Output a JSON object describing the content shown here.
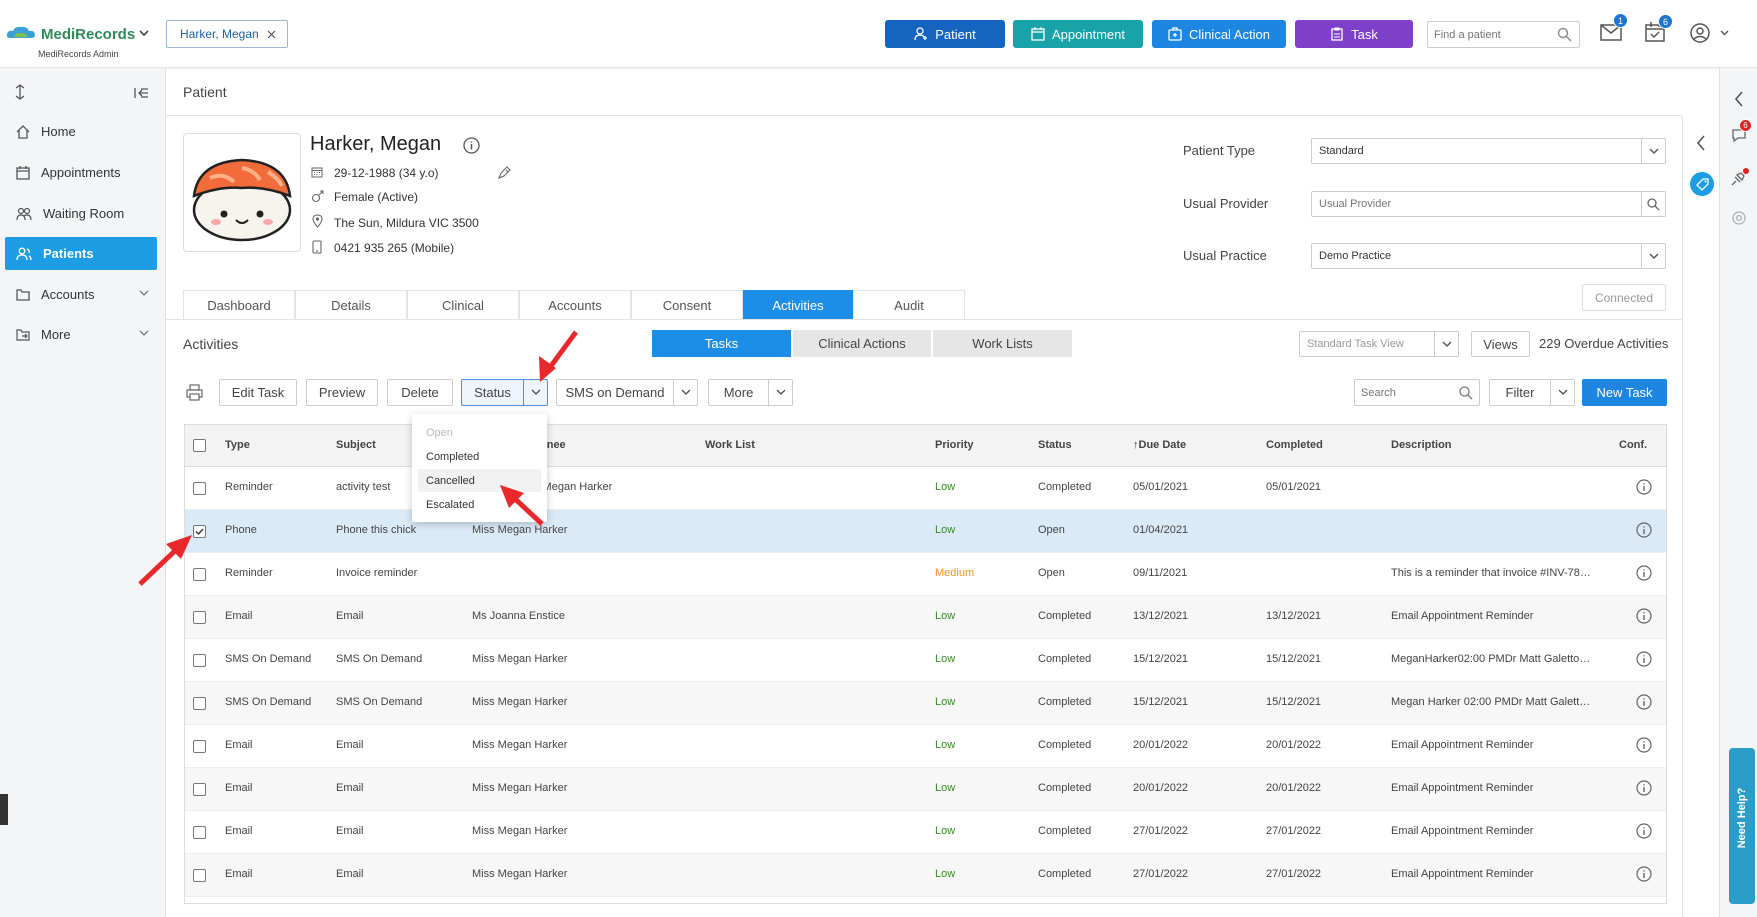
{
  "brand": {
    "name": "MediRecords",
    "sub": "MediRecords Admin"
  },
  "open_patient_tab": "Harker, Megan",
  "top_actions": {
    "patient": "Patient",
    "appointment": "Appointment",
    "clinical_action": "Clinical Action",
    "task": "Task"
  },
  "search": {
    "placeholder": "Find a patient"
  },
  "counts": {
    "mail": "1",
    "tasks": "6",
    "rail_chat": "6"
  },
  "colors": {
    "patient": "#1565c0",
    "appointment": "#17a3a8",
    "clinical_action": "#1d86e0",
    "task": "#7e3fc9",
    "active_nav": "#1d9de3",
    "active_tab": "#1d8ee8",
    "low": "#3a8a2a",
    "medium": "#f0941c",
    "arrow": "#e8282b"
  },
  "sidebar": {
    "items": [
      {
        "label": "Home",
        "icon": "home-icon"
      },
      {
        "label": "Appointments",
        "icon": "calendar-icon"
      },
      {
        "label": "Waiting Room",
        "icon": "people-icon"
      },
      {
        "label": "Patients",
        "icon": "patients-icon"
      },
      {
        "label": "Accounts",
        "icon": "folder-icon"
      },
      {
        "label": "More",
        "icon": "more-icon"
      }
    ]
  },
  "page_title": "Patient",
  "patient": {
    "name": "Harker, Megan",
    "dob": "29-12-1988 (34 y.o)",
    "gender": "Female (Active)",
    "address": "The Sun, Mildura VIC 3500",
    "phone": "0421 935 265 (Mobile)"
  },
  "patient_fields": {
    "type_label": "Patient Type",
    "type_value": "Standard",
    "provider_label": "Usual Provider",
    "provider_placeholder": "Usual Provider",
    "practice_label": "Usual Practice",
    "practice_value": "Demo Practice",
    "connected": "Connected"
  },
  "tabs": [
    "Dashboard",
    "Details",
    "Clinical",
    "Accounts",
    "Consent",
    "Activities",
    "Audit"
  ],
  "activities": {
    "title": "Activities",
    "subtabs": [
      "Tasks",
      "Clinical Actions",
      "Work Lists"
    ],
    "view_value": "Standard Task View",
    "views_label": "Views",
    "overdue": "229 Overdue Activities"
  },
  "toolbar": {
    "edit": "Edit Task",
    "preview": "Preview",
    "delete": "Delete",
    "status": "Status",
    "sms": "SMS on Demand",
    "more": "More",
    "search_placeholder": "Search",
    "filter": "Filter",
    "new_task": "New Task"
  },
  "status_menu": [
    "Open",
    "Completed",
    "Cancelled",
    "Escalated"
  ],
  "table": {
    "headers": {
      "type": "Type",
      "subject": "Subject",
      "assignee": "gnee",
      "worklist": "Work List",
      "priority": "Priority",
      "status": "Status",
      "due": "Due Date",
      "completed": "Completed",
      "description": "Description",
      "conf": "Conf."
    },
    "rows": [
      {
        "type": "Reminder",
        "subject": "activity test",
        "assignee": "s Megan Harker",
        "priority": "Low",
        "status": "Completed",
        "due": "05/01/2021",
        "completed": "05/01/2021",
        "description": ""
      },
      {
        "type": "Phone",
        "subject": "Phone this chick",
        "assignee": "Miss Megan Harker",
        "priority": "Low",
        "status": "Open",
        "due": "01/04/2021",
        "completed": "",
        "description": ""
      },
      {
        "type": "Reminder",
        "subject": "Invoice reminder",
        "assignee": "",
        "priority": "Medium",
        "status": "Open",
        "due": "09/11/2021",
        "completed": "",
        "description": "This is a reminder that invoice #INV-7820 ..."
      },
      {
        "type": "Email",
        "subject": "Email",
        "assignee": "Ms Joanna Enstice",
        "priority": "Low",
        "status": "Completed",
        "due": "13/12/2021",
        "completed": "13/12/2021",
        "description": "Email Appointment Reminder"
      },
      {
        "type": "SMS On Demand",
        "subject": "SMS On Demand",
        "assignee": "Miss Megan Harker",
        "priority": "Low",
        "status": "Completed",
        "due": "15/12/2021",
        "completed": "15/12/2021",
        "description": "MeganHarker02:00 PMDr Matt GalettoMe..."
      },
      {
        "type": "SMS On Demand",
        "subject": "SMS On Demand",
        "assignee": "Miss Megan Harker",
        "priority": "Low",
        "status": "Completed",
        "due": "15/12/2021",
        "completed": "15/12/2021",
        "description": "Megan Harker 02:00 PMDr Matt Galetto ..."
      },
      {
        "type": "Email",
        "subject": "Email",
        "assignee": "Miss Megan Harker",
        "priority": "Low",
        "status": "Completed",
        "due": "20/01/2022",
        "completed": "20/01/2022",
        "description": "Email Appointment Reminder"
      },
      {
        "type": "Email",
        "subject": "Email",
        "assignee": "Miss Megan Harker",
        "priority": "Low",
        "status": "Completed",
        "due": "20/01/2022",
        "completed": "20/01/2022",
        "description": "Email Appointment Reminder"
      },
      {
        "type": "Email",
        "subject": "Email",
        "assignee": "Miss Megan Harker",
        "priority": "Low",
        "status": "Completed",
        "due": "27/01/2022",
        "completed": "27/01/2022",
        "description": "Email Appointment Reminder"
      },
      {
        "type": "Email",
        "subject": "Email",
        "assignee": "Miss Megan Harker",
        "priority": "Low",
        "status": "Completed",
        "due": "27/01/2022",
        "completed": "27/01/2022",
        "description": "Email Appointment Reminder"
      }
    ]
  },
  "help_tab": "Need Help?"
}
